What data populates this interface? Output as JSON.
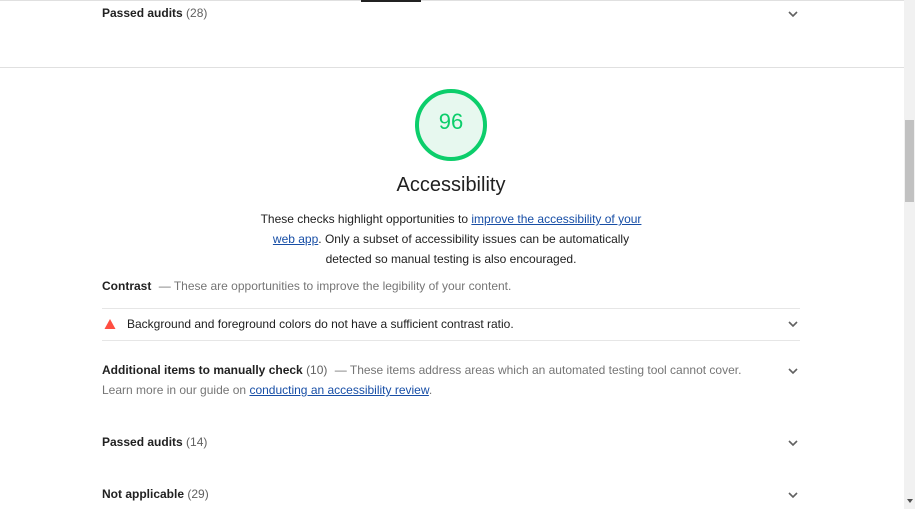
{
  "top_row": {
    "title": "Passed audits",
    "count": "(28)"
  },
  "category": {
    "score": "96",
    "score_color": "#0cce6b",
    "title": "Accessibility",
    "desc_pre": "These checks highlight opportunities to ",
    "desc_link": "improve the accessibility of your web app",
    "desc_post": ". Only a subset of accessibility issues can be automatically detected so manual testing is also encouraged."
  },
  "contrast_group": {
    "title": "Contrast",
    "separator": "—",
    "description": "These are opportunities to improve the legibility of your content."
  },
  "audit": {
    "icon": "warning-triangle-icon",
    "icon_color": "#ff4e42",
    "text": "Background and foreground colors do not have a sufficient contrast ratio."
  },
  "manual_group": {
    "title": "Additional items to manually check",
    "count": "(10)",
    "separator": "—",
    "desc_pre": "These items address areas which an automated testing tool cannot cover. Learn more in our guide on ",
    "desc_link": "conducting an accessibility review",
    "desc_post": "."
  },
  "passed_group": {
    "title": "Passed audits",
    "count": "(14)"
  },
  "na_group": {
    "title": "Not applicable",
    "count": "(29)"
  }
}
